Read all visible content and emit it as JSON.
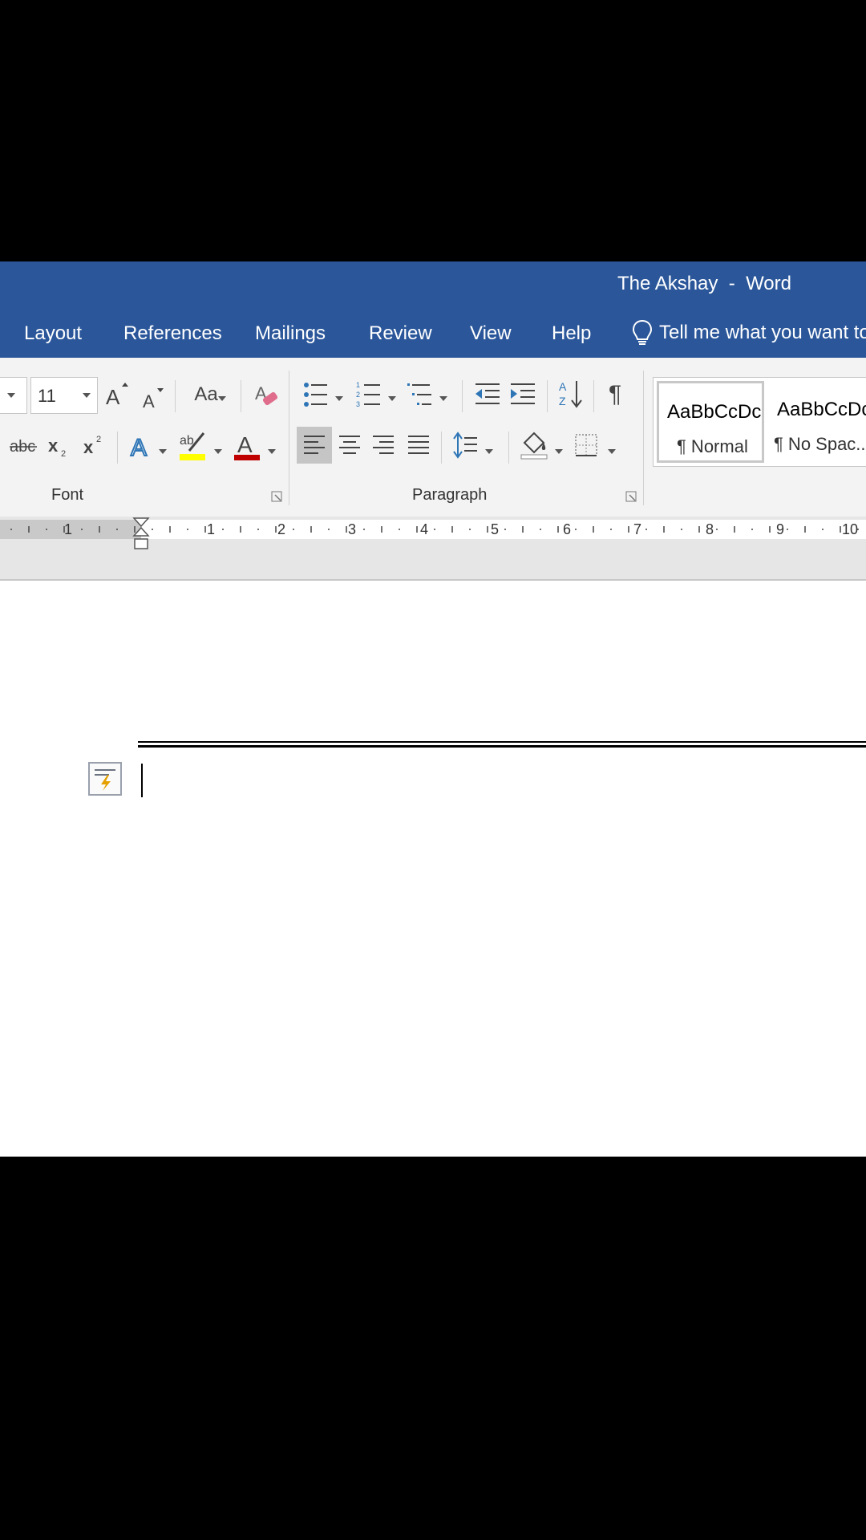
{
  "window": {
    "title": "The Akshay  -  Word"
  },
  "tabs": [
    "Layout",
    "References",
    "Mailings",
    "Review",
    "View",
    "Help"
  ],
  "tell_me": {
    "text": "Tell me what you want to"
  },
  "font": {
    "size_value": "11",
    "change_case_label": "Aa",
    "group_label": "Font"
  },
  "paragraph": {
    "group_label": "Paragraph"
  },
  "styles": [
    {
      "sample": "AaBbCcDc",
      "name": "¶ Normal",
      "selected": true
    },
    {
      "sample": "AaBbCcDc",
      "name": "¶ No Spac..."
    }
  ],
  "ruler": {
    "numbers": [
      "1",
      "1",
      "2",
      "3",
      "4",
      "5",
      "6",
      "7",
      "8",
      "9",
      "10"
    ]
  },
  "colors": {
    "brand_blue": "#2b579a",
    "highlight_yellow": "#ffff00",
    "font_red": "#c00000"
  }
}
